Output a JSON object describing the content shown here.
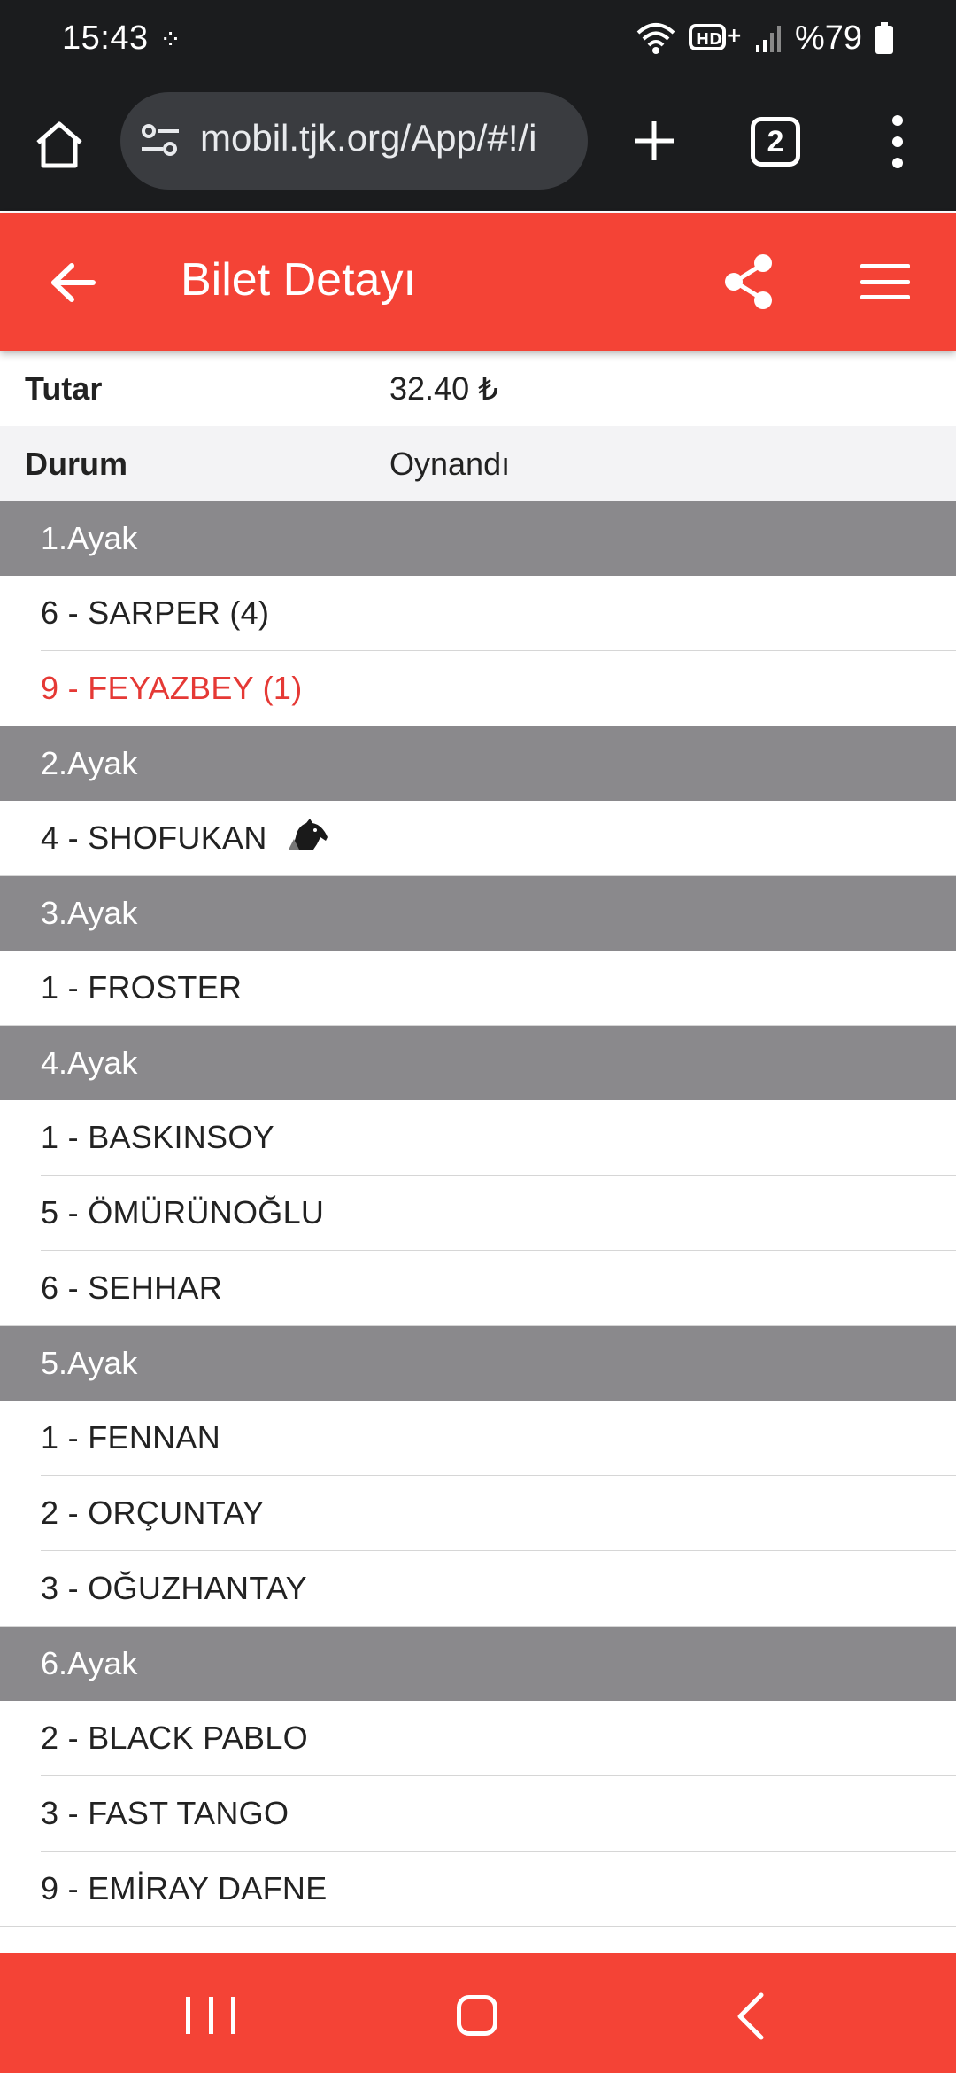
{
  "status_bar": {
    "time": "15:43",
    "battery": "%79",
    "network": "HD+"
  },
  "browser": {
    "url": "mobil.tjk.org/App/#!/i",
    "tab_count": "2"
  },
  "header": {
    "title": "Bilet Detayı"
  },
  "info": [
    {
      "label": "Tutar",
      "value": "32.40 ₺"
    },
    {
      "label": "Durum",
      "value": "Oynandı"
    }
  ],
  "legs": [
    {
      "title": "1.Ayak",
      "horses": [
        {
          "text": "6 - SARPER (4)",
          "winner": false
        },
        {
          "text": "9 - FEYAZBEY (1)",
          "winner": true
        }
      ]
    },
    {
      "title": "2.Ayak",
      "horses": [
        {
          "text": "4 - SHOFUKAN",
          "winner": false,
          "icon": "horse-head-icon"
        }
      ]
    },
    {
      "title": "3.Ayak",
      "horses": [
        {
          "text": "1 - FROSTER",
          "winner": false
        }
      ]
    },
    {
      "title": "4.Ayak",
      "horses": [
        {
          "text": "1 - BASKINSOY",
          "winner": false
        },
        {
          "text": "5 - ÖMÜRÜNOĞLU",
          "winner": false
        },
        {
          "text": "6 - SEHHAR",
          "winner": false
        }
      ]
    },
    {
      "title": "5.Ayak",
      "horses": [
        {
          "text": "1 - FENNAN",
          "winner": false
        },
        {
          "text": "2 - ORÇUNTAY",
          "winner": false
        },
        {
          "text": "3 - OĞUZHANTAY",
          "winner": false
        }
      ]
    },
    {
      "title": "6.Ayak",
      "horses": [
        {
          "text": "2 - BLACK PABLO",
          "winner": false
        },
        {
          "text": "3 - FAST TANGO",
          "winner": false
        },
        {
          "text": "9 - EMİRAY DAFNE",
          "winner": false
        }
      ]
    }
  ],
  "colors": {
    "accent": "#f44336",
    "leg_header": "#8a898c",
    "winner": "#e53935",
    "browser_bg": "#1b1c1e"
  }
}
